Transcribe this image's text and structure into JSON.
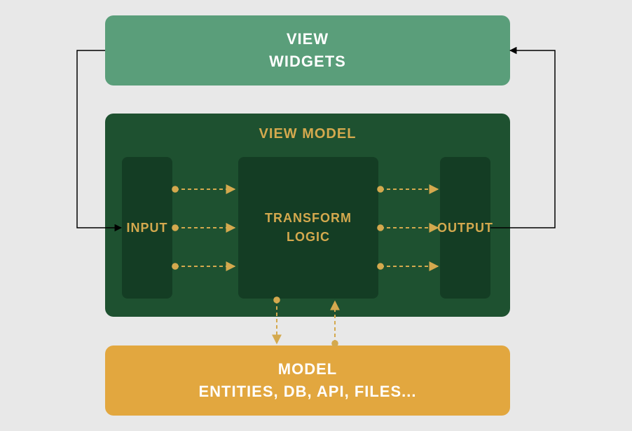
{
  "view": {
    "title": "VIEW",
    "subtitle": "WIDGETS"
  },
  "viewmodel": {
    "title": "VIEW MODEL",
    "input": "INPUT",
    "transform_line1": "TRANSFORM",
    "transform_line2": "LOGIC",
    "output": "OUTPUT"
  },
  "model": {
    "title": "MODEL",
    "subtitle": "ENTITIES, DB, API, FILES..."
  },
  "colors": {
    "view_bg": "#5a9e7a",
    "viewmodel_bg": "#1e5130",
    "viewmodel_inner_bg": "#143d24",
    "model_bg": "#e2a73f",
    "accent_text": "#d4a94e",
    "light_text": "#ffffff",
    "solid_arrow": "#000000",
    "dashed_arrow": "#d4a94e"
  }
}
